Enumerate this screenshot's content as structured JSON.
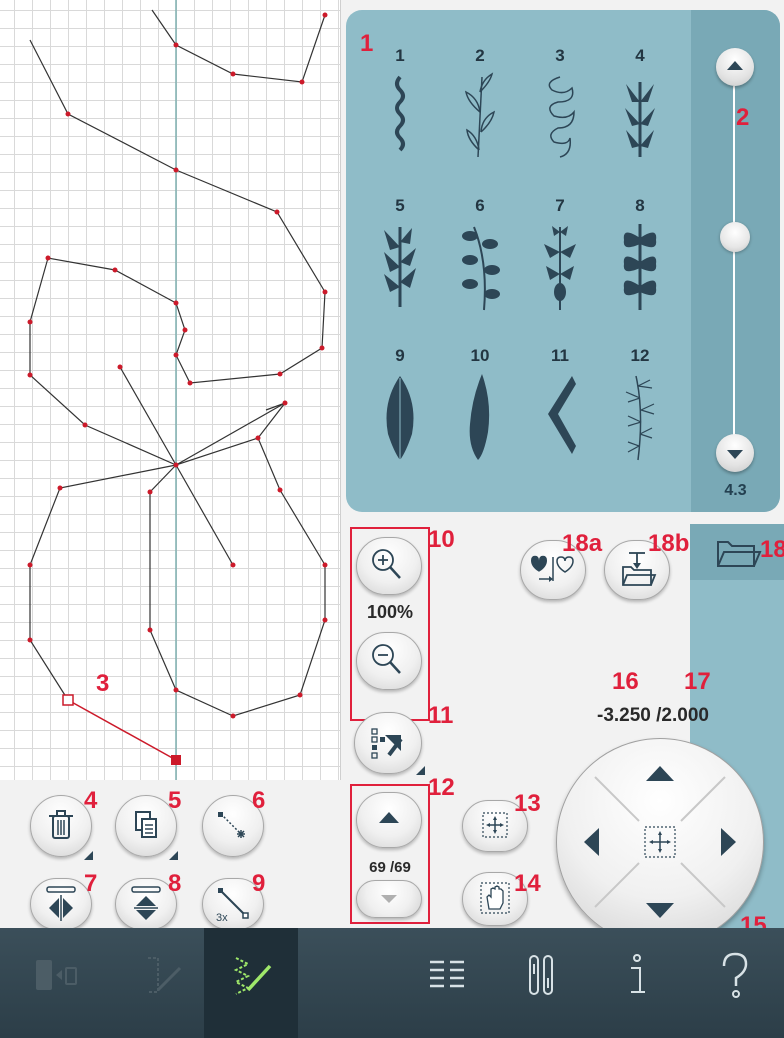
{
  "stitch_menu": {
    "stitches": [
      {
        "number": "1"
      },
      {
        "number": "2"
      },
      {
        "number": "3"
      },
      {
        "number": "4"
      },
      {
        "number": "5"
      },
      {
        "number": "6"
      },
      {
        "number": "7"
      },
      {
        "number": "8"
      },
      {
        "number": "9"
      },
      {
        "number": "10"
      },
      {
        "number": "11"
      },
      {
        "number": "12"
      }
    ],
    "scroll_value": "4.3"
  },
  "zoom": {
    "label": "100%"
  },
  "stitch_position": {
    "label": "69 /69"
  },
  "coordinates": {
    "label": "-3.250 /2.000"
  },
  "callouts": {
    "c1": "1",
    "c2": "2",
    "c3": "3",
    "c4": "4",
    "c5": "5",
    "c6": "6",
    "c7": "7",
    "c8": "8",
    "c9": "9",
    "c10": "10",
    "c11": "11",
    "c12": "12",
    "c13": "13",
    "c14": "14",
    "c15": "15",
    "c16": "16",
    "c17": "17",
    "c18": "18",
    "c18a": "18a",
    "c18b": "18b"
  },
  "icons": {
    "delete": "trash-icon",
    "duplicate": "copy-icon",
    "insert": "insert-point-icon",
    "mirror_side": "mirror-side-to-side-icon",
    "mirror_end": "mirror-end-to-end-icon",
    "triple": "triple-stitch-icon",
    "zoom_in": "zoom-in-icon",
    "zoom_out": "zoom-out-icon",
    "select": "select-points-icon",
    "center": "center-icon",
    "pan": "pan-icon",
    "save_personal": "save-personal-menu-icon",
    "load": "load-stitch-icon",
    "folder": "folder-icon",
    "toolbar": [
      "jumbo-stitch-icon",
      "stitch-program-icon",
      "stitch-creator-icon",
      "selection-menu-icon",
      "settings-icon",
      "info-icon",
      "help-icon"
    ]
  },
  "colors": {
    "accent_red": "#e0203c",
    "panel_blue": "#8fbcc8",
    "dark_blue": "#2d4656",
    "toolbar": "#34474f"
  }
}
